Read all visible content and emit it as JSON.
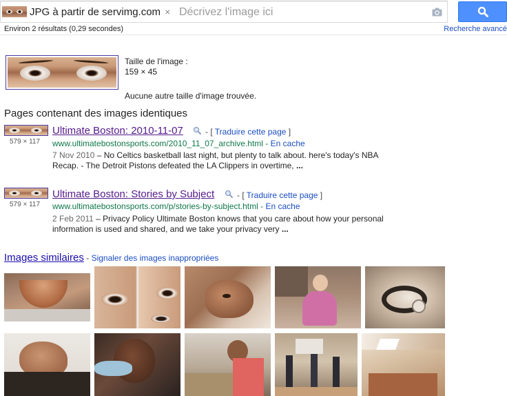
{
  "search": {
    "chip_label": "JPG à partir de servimg.com",
    "chip_close": "×",
    "placeholder": "Décrivez l'image ici"
  },
  "stats": {
    "results": "Environ 2 résultats (0,29 secondes)",
    "advanced_search": "Recherche avancé"
  },
  "query_image": {
    "size_label": "Taille de l'image :",
    "size_value": "159 × 45",
    "no_other_sizes": "Aucune autre taille d'image trouvée."
  },
  "pages_section_title": "Pages contenant des images identiques",
  "results": [
    {
      "dimensions": "579 × 117",
      "title": "Ultimate Boston: 2010-11-07",
      "tail_prefix": "- [",
      "translate": "Traduire cette page",
      "tail_suffix": "]",
      "url": "www.ultimatebostonsports.com/2010_11_07_archive.html",
      "url_sep": "-",
      "cache": "En cache",
      "date": "7 Nov 2010",
      "snippet_line1": " – No Celtics basketball last night, but plenty to talk about. here's today's NBA",
      "snippet_line2": "Recap. - The Detroit Pistons defeated the LA Clippers in overtime, ",
      "ellipsis": "..."
    },
    {
      "dimensions": "579 × 117",
      "title": "Ultimate Boston: Stories by Subject",
      "tail_prefix": "- [",
      "translate": "Traduire cette page",
      "tail_suffix": "]",
      "url": "www.ultimatebostonsports.com/p/stories-by-subject.html",
      "url_sep": "-",
      "cache": "En cache",
      "date": "2 Feb 2011",
      "snippet_line1": " – Privacy Policy Ultimate Boston knows that you care about how your personal",
      "snippet_line2": "information is used and shared, and we take your privacy very ",
      "ellipsis": "..."
    }
  ],
  "similar": {
    "title": "Images similaires",
    "separator": "-",
    "report": "Signaler des images inappropriées"
  },
  "icons": {
    "camera": "camera-icon",
    "search": "magnifier-icon",
    "close": "close-icon",
    "preview": "magnifier-icon"
  },
  "colors": {
    "accent_button": "#4d90fe",
    "link": "#1a0dab",
    "visited": "#551a8b",
    "url_green": "#0e774a"
  }
}
